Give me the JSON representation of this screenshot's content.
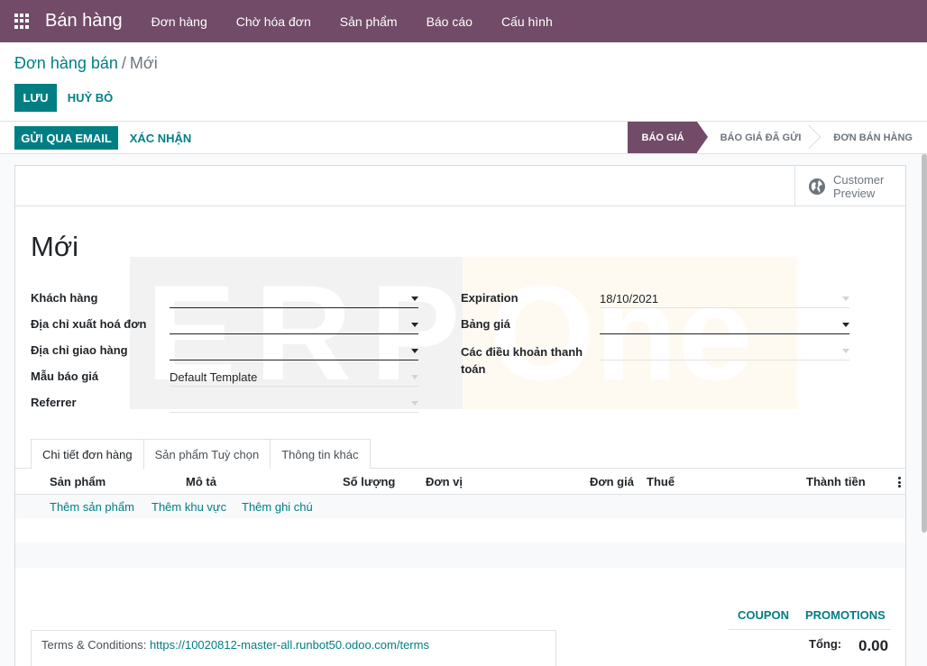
{
  "navbar": {
    "brand": "Bán hàng",
    "menu": [
      "Đơn hàng",
      "Chờ hóa đơn",
      "Sản phẩm",
      "Báo cáo",
      "Cấu hình"
    ]
  },
  "breadcrumb": {
    "parent": "Đơn hàng bán",
    "separator": "/",
    "current": "Mới"
  },
  "actions": {
    "save": "LƯU",
    "discard": "HUỶ BỎ"
  },
  "statusbar": {
    "send_email": "GỬI QUA EMAIL",
    "confirm": "XÁC NHẬN",
    "stages": [
      "BÁO GIÁ",
      "BÁO GIÁ ĐÃ GỬI",
      "ĐƠN BÁN HÀNG"
    ],
    "active_stage": "BÁO GIÁ"
  },
  "smart_button": {
    "line1": "Customer",
    "line2": "Preview"
  },
  "record": {
    "title": "Mới"
  },
  "fields_left": [
    {
      "label": "Khách hàng",
      "value": ""
    },
    {
      "label": "Địa chỉ xuất hoá đơn",
      "value": ""
    },
    {
      "label": "Địa chỉ giao hàng",
      "value": ""
    },
    {
      "label": "Mẫu báo giá",
      "value": "Default Template"
    },
    {
      "label": "Referrer",
      "value": ""
    }
  ],
  "fields_right": [
    {
      "label": "Expiration",
      "value": "18/10/2021"
    },
    {
      "label": "Bảng giá",
      "value": ""
    },
    {
      "label_line1": "Các điều khoản thanh",
      "label_line2": "toán",
      "value": ""
    }
  ],
  "watermark": {
    "left": "ERP",
    "right": "One"
  },
  "tabs": [
    "Chi tiết đơn hàng",
    "Sản phẩm Tuỳ chọn",
    "Thông tin khác"
  ],
  "table": {
    "columns": [
      "Sản phẩm",
      "Mô tả",
      "Số lượng",
      "Đơn vị",
      "Đơn giá",
      "Thuế",
      "Thành tiền"
    ],
    "add_links": [
      "Thêm sản phẩm",
      "Thêm khu vực",
      "Thêm ghi chú"
    ]
  },
  "footer": {
    "coupon": "COUPON",
    "promotions": "PROMOTIONS",
    "total_label": "Tổng:",
    "total_value": "0.00",
    "terms_label": "Terms & Conditions:",
    "terms_url": "https://10020812-master-all.runbot50.odoo.com/terms"
  },
  "colors": {
    "brand": "#714b67",
    "accent": "#017e84"
  }
}
